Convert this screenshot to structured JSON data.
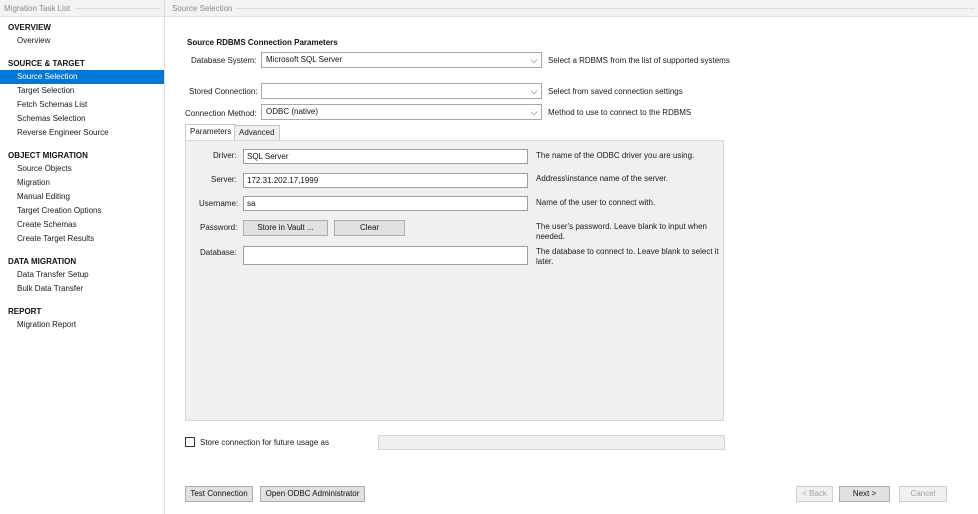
{
  "sidebar": {
    "header": "Migration Task List",
    "sections": [
      {
        "title": "OVERVIEW",
        "items": [
          {
            "label": "Overview",
            "selected": false
          }
        ]
      },
      {
        "title": "SOURCE & TARGET",
        "items": [
          {
            "label": "Source Selection",
            "selected": true
          },
          {
            "label": "Target Selection",
            "selected": false
          },
          {
            "label": "Fetch Schemas List",
            "selected": false
          },
          {
            "label": "Schemas Selection",
            "selected": false
          },
          {
            "label": "Reverse Engineer Source",
            "selected": false
          }
        ]
      },
      {
        "title": "OBJECT MIGRATION",
        "items": [
          {
            "label": "Source Objects",
            "selected": false
          },
          {
            "label": "Migration",
            "selected": false
          },
          {
            "label": "Manual Editing",
            "selected": false
          },
          {
            "label": "Target Creation Options",
            "selected": false
          },
          {
            "label": "Create Schemas",
            "selected": false
          },
          {
            "label": "Create Target Results",
            "selected": false
          }
        ]
      },
      {
        "title": "DATA MIGRATION",
        "items": [
          {
            "label": "Data Transfer Setup",
            "selected": false
          },
          {
            "label": "Bulk Data Transfer",
            "selected": false
          }
        ]
      },
      {
        "title": "REPORT",
        "items": [
          {
            "label": "Migration Report",
            "selected": false
          }
        ]
      }
    ]
  },
  "main": {
    "header": "Source Selection",
    "title": "Source RDBMS Connection Parameters",
    "database_system": {
      "label": "Database System:",
      "value": "Microsoft SQL Server",
      "hint": "Select a RDBMS from the list of supported systems"
    },
    "stored_connection": {
      "label": "Stored Connection:",
      "value": "",
      "hint": "Select from saved connection settings"
    },
    "connection_method": {
      "label": "Connection Method:",
      "value": "ODBC (native)",
      "hint": "Method to use to connect to the RDBMS"
    },
    "tabs": [
      {
        "label": "Parameters",
        "active": true
      },
      {
        "label": "Advanced",
        "active": false
      }
    ],
    "params": {
      "driver": {
        "label": "Driver:",
        "value": "SQL Server",
        "hint": "The name of the ODBC driver you are using."
      },
      "server": {
        "label": "Server:",
        "value": "172.31.202.17,1999",
        "hint": "Address\\instance name of the server."
      },
      "username": {
        "label": "Username:",
        "value": "sa",
        "hint": "Name of the user to connect with."
      },
      "password": {
        "label": "Password:",
        "store_label": "Store in Vault ...",
        "clear_label": "Clear",
        "hint": "The user's password. Leave blank to input when needed."
      },
      "database": {
        "label": "Database:",
        "value": "",
        "hint": "The database to connect to. Leave blank to select it later."
      }
    },
    "store_connection": {
      "label": "Store connection for future usage as",
      "checked": false,
      "value": ""
    },
    "buttons": {
      "test_connection": "Test Connection",
      "open_odbc_admin": "Open ODBC Administrator",
      "back": "< Back",
      "next": "Next >",
      "cancel": "Cancel"
    }
  },
  "icons": {
    "dropdown": "chevron-down-icon"
  },
  "colors": {
    "selection": "#0078d7"
  }
}
